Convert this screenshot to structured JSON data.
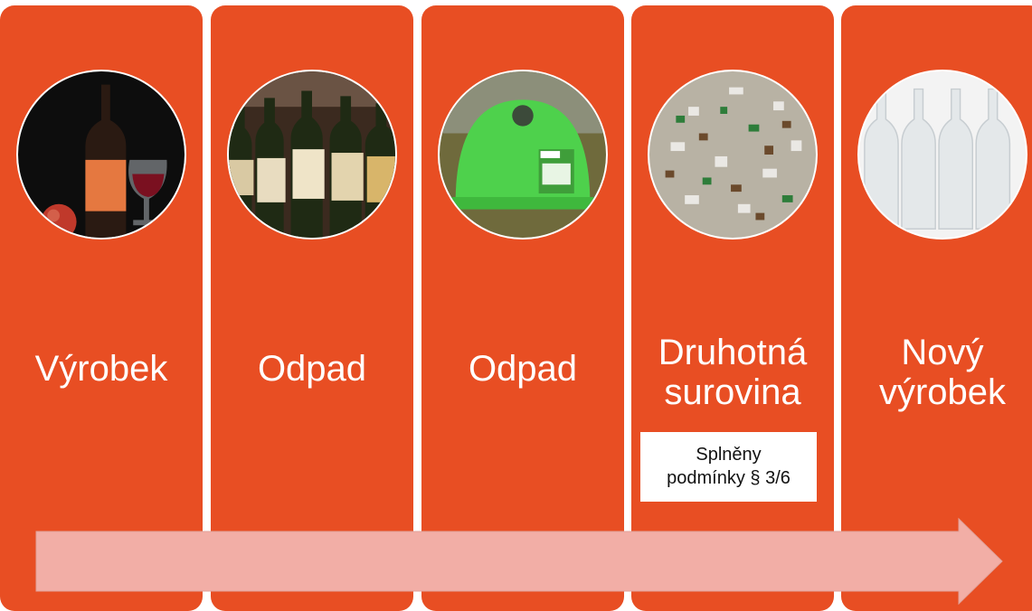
{
  "steps": [
    {
      "label": "Výrobek",
      "image": "wine-bottle-glass-photo"
    },
    {
      "label": "Odpad",
      "image": "old-wine-bottles-photo"
    },
    {
      "label": "Odpad",
      "image": "green-glass-bin-photo"
    },
    {
      "label": "Druhotná surovina",
      "image": "glass-cullet-photo",
      "note": "Splněny podmínky § 3/6"
    },
    {
      "label": "Nový výrobek",
      "image": "new-clear-bottles-photo"
    }
  ],
  "colors": {
    "panel": "#e84e23",
    "arrow": "#f2aea6",
    "arrow_stroke": "#e0a29a",
    "label": "#ffffff"
  }
}
